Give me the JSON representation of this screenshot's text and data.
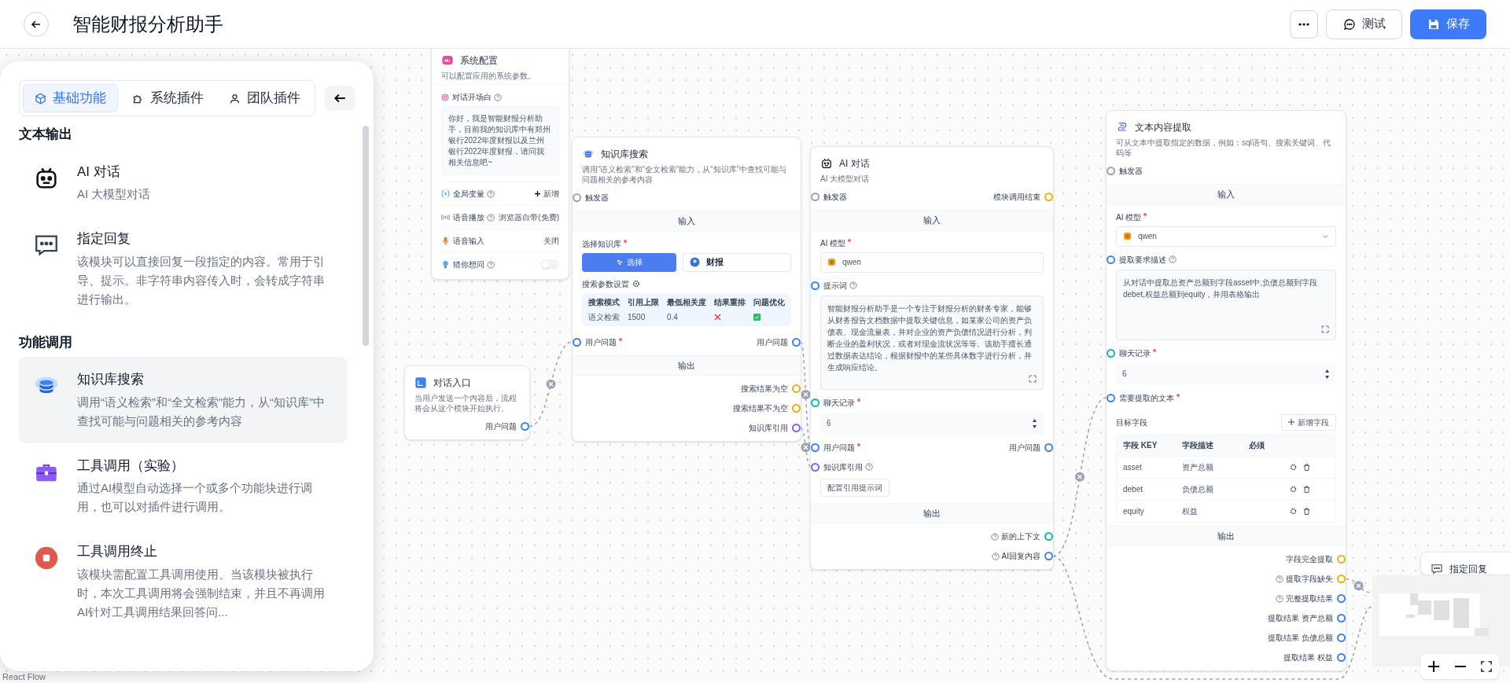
{
  "header": {
    "title": "智能财报分析助手",
    "buttons": [
      {
        "kind": "secondary",
        "label": "测试"
      },
      {
        "kind": "primary",
        "label": "保存"
      }
    ]
  },
  "sidebar": {
    "tabs": [
      {
        "label": "基础功能",
        "selected": true
      },
      {
        "label": "系统插件",
        "selected": false
      },
      {
        "label": "团队插件",
        "selected": false
      }
    ],
    "sections": [
      {
        "title": "文本输出",
        "items": [
          {
            "title": "AI 对话",
            "desc": "AI 大模型对话",
            "selected": false
          },
          {
            "title": "指定回复",
            "desc": "该模块可以直接回复一段指定的内容。常用于引导、提示。非字符串内容传入时，会转成字符串进行输出。",
            "selected": false
          }
        ]
      },
      {
        "title": "功能调用",
        "items": [
          {
            "title": "知识库搜索",
            "desc": "调用“语义检索”和“全文检索”能力，从“知识库”中查找可能与问题相关的参考内容",
            "selected": true
          },
          {
            "title": "工具调用（实验）",
            "desc": "通过AI模型自动选择一个或多个功能块进行调用，也可以对插件进行调用。",
            "selected": false
          },
          {
            "title": "工具调用终止",
            "desc": "该模块需配置工具调用使用。当该模块被执行时，本次工具调用将会强制结束，并且不再调用AI针对工具调用结果回答问...",
            "selected": false
          }
        ]
      }
    ]
  },
  "nodes": [
    {
      "kind": "system_config",
      "title": "系统配置",
      "desc": "可以配置应用的系统参数。",
      "rows": [
        {
          "kind": "opening",
          "label": "对话开场白",
          "help": true,
          "value": "你好，我是智能财报分析助手，目前我的知识库中有郑州银行2022年度财报以及兰州银行2022年度财报，请问我相关信息吧~"
        },
        {
          "kind": "setting",
          "label": "全局变量",
          "help": true,
          "value": "新增",
          "add": true
        },
        {
          "kind": "setting",
          "label": "语音播放",
          "help": true,
          "value": "浏览器自带(免费)"
        },
        {
          "kind": "setting",
          "label": "语音输入",
          "help": false,
          "value": "关闭"
        },
        {
          "kind": "setting",
          "label": "猜你想问",
          "help": true,
          "on": false
        }
      ]
    },
    {
      "kind": "module",
      "title": "对话入口",
      "desc": "当用户发送一个内容后，流程将会从这个模块开始执行。",
      "rows": [
        {
          "kind": "port",
          "right": {
            "label": "用户问题",
            "color": "#3b82f6"
          }
        }
      ]
    },
    {
      "kind": "module",
      "title": "知识库搜索",
      "desc": "调用“语义检索”和“全文检索”能力，从“知识库”中查找可能与问题相关的参考内容",
      "rows": [
        {
          "kind": "port",
          "left": {
            "label": "触发器",
            "color": "#9ca3af"
          }
        },
        {
          "kind": "section",
          "label": "输入"
        },
        {
          "kind": "label",
          "label": "选择知识库",
          "required": true
        },
        {
          "kind": "kb_select",
          "button": "选择",
          "dataset": "财报"
        },
        {
          "kind": "params",
          "label": "搜索参数设置"
        },
        {
          "kind": "search_table",
          "columns": [
            "搜索模式",
            "引用上限",
            "最低相关度",
            "结果重排",
            "问题优化"
          ],
          "cells": [
            "语义检索",
            "1500",
            "0.4"
          ],
          "rerank": false,
          "optimize": true
        },
        {
          "kind": "port",
          "left": {
            "label": "用户问题",
            "required": true,
            "color": "#3b82f6"
          },
          "right": {
            "label": "用户问题",
            "color": "#3b82f6"
          }
        },
        {
          "kind": "section",
          "label": "输出"
        },
        {
          "kind": "port",
          "right": {
            "label": "搜索结果为空",
            "color": "#eab308"
          }
        },
        {
          "kind": "port",
          "right": {
            "label": "搜索结果不为空",
            "color": "#eab308"
          }
        },
        {
          "kind": "port",
          "right": {
            "label": "知识库引用",
            "color": "#8b5cf6"
          }
        }
      ]
    },
    {
      "kind": "module",
      "title": "AI 对话",
      "desc": "AI 大模型对话",
      "rows": [
        {
          "kind": "port",
          "left": {
            "label": "触发器",
            "color": "#9ca3af"
          },
          "right": {
            "label": "模块调用结束",
            "color": "#eab308"
          }
        },
        {
          "kind": "section",
          "label": "输入"
        },
        {
          "kind": "label",
          "label": "AI 模型",
          "required": true
        },
        {
          "kind": "select",
          "value": "qwen",
          "dropdown": false
        },
        {
          "kind": "port",
          "left": {
            "label": "提示词",
            "help": true,
            "color": "#3b82f6"
          }
        },
        {
          "kind": "textarea",
          "value": "智能财报分析助手是一个专注于财报分析的财务专家，能够从财务报告文档数据中提取关键信息，如某家公司的资产负债表、现金流量表，并对企业的资产负债情况进行分析，判断企业的盈利状况，或者对现金流状况等等。该助手擅长通过数据表达结论，根据财报中的某些具体数字进行分析，并生成响应结论。"
        },
        {
          "kind": "port",
          "left": {
            "label": "聊天记录",
            "required": true,
            "color": "#14b8a6"
          }
        },
        {
          "kind": "number",
          "value": "6"
        },
        {
          "kind": "port",
          "left": {
            "label": "用户问题",
            "required": true,
            "color": "#3b82f6"
          },
          "right": {
            "label": "用户问题",
            "color": "#3b82f6"
          }
        },
        {
          "kind": "port",
          "left": {
            "label": "知识库引用",
            "help": true,
            "color": "#8b5cf6"
          }
        },
        {
          "kind": "button",
          "label": "配置引用提示词"
        },
        {
          "kind": "section",
          "label": "输出"
        },
        {
          "kind": "port",
          "right": {
            "label": "新的上下文",
            "help": true,
            "color": "#14b8a6"
          }
        },
        {
          "kind": "port",
          "right": {
            "label": "AI回复内容",
            "help": true,
            "color": "#3b82f6"
          }
        }
      ]
    },
    {
      "kind": "module",
      "title": "文本内容提取",
      "desc": "可从文本中提取指定的数据，例如：sql语句、搜索关键词、代码等",
      "rows": [
        {
          "kind": "port",
          "left": {
            "label": "触发器",
            "color": "#9ca3af"
          }
        },
        {
          "kind": "section",
          "label": "输入"
        },
        {
          "kind": "label",
          "label": "AI 模型",
          "required": true
        },
        {
          "kind": "select",
          "value": "qwen",
          "dropdown": true
        },
        {
          "kind": "port",
          "left": {
            "label": "提取要求描述",
            "help": true,
            "color": "#3b82f6"
          }
        },
        {
          "kind": "textarea",
          "value": "从对话中提取总资产总额到字段asset中,负债总额到字段debet,权益总额到equity，并用表格输出"
        },
        {
          "kind": "port",
          "left": {
            "label": "聊天记录",
            "required": true,
            "color": "#14b8a6"
          }
        },
        {
          "kind": "number",
          "value": "6"
        },
        {
          "kind": "port",
          "left": {
            "label": "需要提取的文本",
            "required": true,
            "color": "#3b82f6"
          }
        },
        {
          "kind": "fields_header",
          "label": "目标字段",
          "button": "新增字段"
        },
        {
          "kind": "fields_table",
          "columns": [
            "字段 KEY",
            "字段描述",
            "必须"
          ],
          "rows": [
            {
              "key": "asset",
              "desc": "资产总额"
            },
            {
              "key": "debet",
              "desc": "负债总额"
            },
            {
              "key": "equity",
              "desc": "权益"
            }
          ]
        },
        {
          "kind": "section",
          "label": "输出"
        },
        {
          "kind": "port",
          "right": {
            "label": "字段完全提取",
            "color": "#eab308"
          }
        },
        {
          "kind": "port",
          "right": {
            "label": "提取字段缺失",
            "help": true,
            "color": "#eab308"
          }
        },
        {
          "kind": "port",
          "right": {
            "label": "完整提取结果",
            "help": true,
            "color": "#3b82f6"
          }
        },
        {
          "kind": "port",
          "right": {
            "label": "提取结果 资产总额",
            "color": "#3b82f6"
          }
        },
        {
          "kind": "port",
          "right": {
            "label": "提取结果 负债总额",
            "color": "#3b82f6"
          }
        },
        {
          "kind": "port",
          "right": {
            "label": "提取结果 权益",
            "color": "#3b82f6"
          }
        }
      ]
    },
    {
      "kind": "module",
      "title": "指定回复"
    }
  ],
  "attribution": "React Flow"
}
